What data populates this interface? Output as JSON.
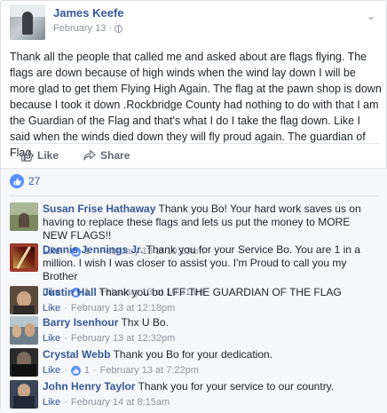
{
  "post": {
    "author": "James Keefe",
    "date": "February 13",
    "text": "Thank all the people that called me and asked about are flags flying. The flags are down because of high winds when the wind lay down I will be more glad to get them Flying High Again. The flag at the pawn shop is down because I took it down .Rockbridge County had nothing to do with that I am the Guardian of the Flag and that's what I do I take the flag down. Like I said when the winds died down they will fly proud again. The guardian of Flag.",
    "like_label": "Like",
    "share_label": "Share",
    "reaction_count": "27"
  },
  "comments": [
    {
      "name": "Susan Frise Hathaway",
      "text": " Thank you Bo! Your hard work saves us on having to replace these flags and lets us put the money to MORE NEW FLAGS!!",
      "like_label": "Like",
      "likes": "1",
      "date": "February 13 at 10:13am",
      "avatar_color": "#7a8a5e"
    },
    {
      "name": "Dennis Jennings Jr.",
      "text": " Thank you for your Service Bo. You are 1 in a million. I wish I was closer to assist you. I'm Proud to call you my Brother",
      "like_label": "Like",
      "likes": "1",
      "date": "February 13 at 10:31am",
      "avatar_color": "#9b3b2a"
    },
    {
      "name": "Justin Hall",
      "text": " Thank you bo LFF THE GUARDIAN OF THE FLAG",
      "like_label": "Like",
      "date": "February 13 at 12:18pm",
      "avatar_color": "#5a4a3c"
    },
    {
      "name": "Barry Isenhour",
      "text": " Thx U Bo.",
      "like_label": "Like",
      "date": "February 13 at 12:32pm",
      "avatar_color": "#6f7f8a"
    },
    {
      "name": "Crystal Webb",
      "text": " Thank you Bo for your dedication.",
      "like_label": "Like",
      "likes": "1",
      "date": "February 13 at 7:22pm",
      "avatar_color": "#2b2b2b"
    },
    {
      "name": "John Henry Taylor",
      "text": " Thank you for your service to our country.",
      "like_label": "Like",
      "date": "February 14 at 8:15am",
      "avatar_color": "#3a4656"
    }
  ],
  "colors": {
    "link": "#365899",
    "meta": "#90949c",
    "like_badge": "#5890ff",
    "comments_bg": "#f6f7f9"
  },
  "icons": {
    "privacy": "globe-icon",
    "options": "chevron-down-icon",
    "like": "thumbs-up-icon",
    "share": "share-arrow-icon"
  }
}
